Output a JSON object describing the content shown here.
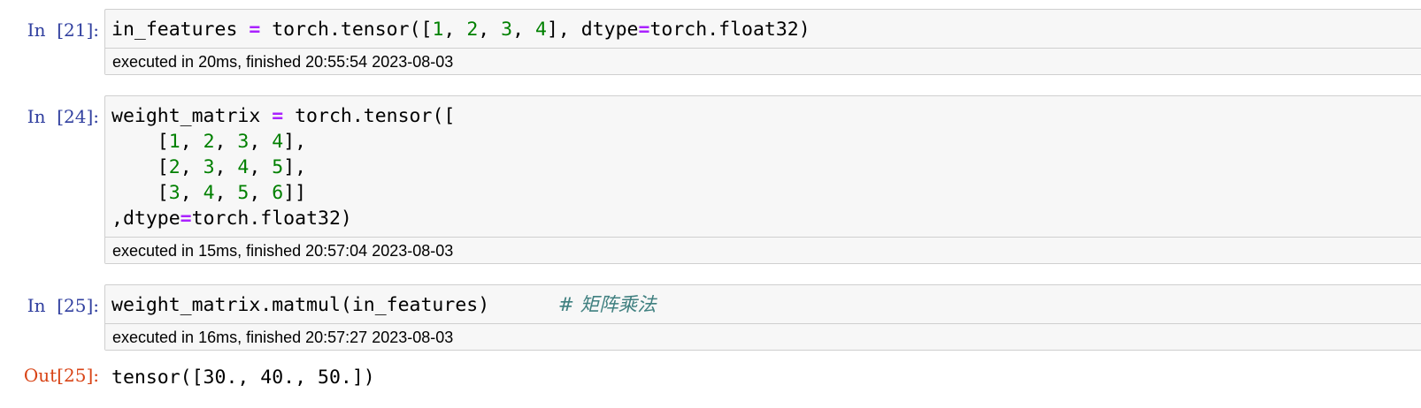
{
  "cells": [
    {
      "prompt": "In  [21]:",
      "code_tokens": [
        [
          "in_features ",
          "t"
        ],
        [
          "=",
          "op"
        ],
        [
          " torch.tensor([",
          "t"
        ],
        [
          "1",
          "num"
        ],
        [
          ", ",
          "t"
        ],
        [
          "2",
          "num"
        ],
        [
          ", ",
          "t"
        ],
        [
          "3",
          "num"
        ],
        [
          ", ",
          "t"
        ],
        [
          "4",
          "num"
        ],
        [
          "], dtype",
          "t"
        ],
        [
          "=",
          "op"
        ],
        [
          "torch.float32)",
          "t"
        ]
      ],
      "timing": "executed in 20ms, finished 20:55:54 2023-08-03"
    },
    {
      "prompt": "In  [24]:",
      "code_tokens": [
        [
          "weight_matrix ",
          "t"
        ],
        [
          "=",
          "op"
        ],
        [
          " torch.tensor([\n    [",
          "t"
        ],
        [
          "1",
          "num"
        ],
        [
          ", ",
          "t"
        ],
        [
          "2",
          "num"
        ],
        [
          ", ",
          "t"
        ],
        [
          "3",
          "num"
        ],
        [
          ", ",
          "t"
        ],
        [
          "4",
          "num"
        ],
        [
          "],\n    [",
          "t"
        ],
        [
          "2",
          "num"
        ],
        [
          ", ",
          "t"
        ],
        [
          "3",
          "num"
        ],
        [
          ", ",
          "t"
        ],
        [
          "4",
          "num"
        ],
        [
          ", ",
          "t"
        ],
        [
          "5",
          "num"
        ],
        [
          "],\n    [",
          "t"
        ],
        [
          "3",
          "num"
        ],
        [
          ", ",
          "t"
        ],
        [
          "4",
          "num"
        ],
        [
          ", ",
          "t"
        ],
        [
          "5",
          "num"
        ],
        [
          ", ",
          "t"
        ],
        [
          "6",
          "num"
        ],
        [
          "]]\n,dtype",
          "t"
        ],
        [
          "=",
          "op"
        ],
        [
          "torch.float32)",
          "t"
        ]
      ],
      "timing": "executed in 15ms, finished 20:57:04 2023-08-03"
    },
    {
      "prompt": "In  [25]:",
      "code_tokens": [
        [
          "weight_matrix.matmul(in_features)      ",
          "t"
        ],
        [
          "# 矩阵乘法",
          "cm"
        ]
      ],
      "timing": "executed in 16ms, finished 20:57:27 2023-08-03",
      "out_prompt": "Out[25]:",
      "output": "tensor([30., 40., 50.])"
    }
  ]
}
